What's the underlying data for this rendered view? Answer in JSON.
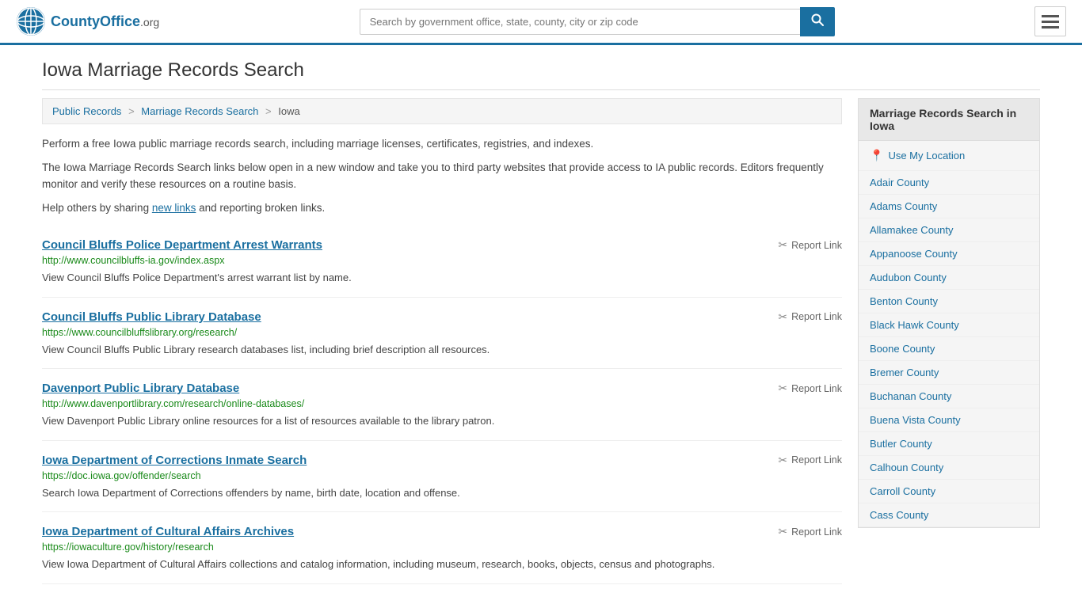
{
  "header": {
    "logo_text": "CountyOffice",
    "logo_org": ".org",
    "search_placeholder": "Search by government office, state, county, city or zip code"
  },
  "page": {
    "title": "Iowa Marriage Records Search",
    "breadcrumb": {
      "items": [
        "Public Records",
        "Marriage Records Search",
        "Iowa"
      ]
    },
    "description1": "Perform a free Iowa public marriage records search, including marriage licenses, certificates, registries, and indexes.",
    "description2": "The Iowa Marriage Records Search links below open in a new window and take you to third party websites that provide access to IA public records. Editors frequently monitor and verify these resources on a routine basis.",
    "description3_before": "Help others by sharing ",
    "description3_link": "new links",
    "description3_after": " and reporting broken links."
  },
  "results": [
    {
      "title": "Council Bluffs Police Department Arrest Warrants",
      "url": "http://www.councilbluffs-ia.gov/index.aspx",
      "description": "View Council Bluffs Police Department's arrest warrant list by name.",
      "report_label": "Report Link"
    },
    {
      "title": "Council Bluffs Public Library Database",
      "url": "https://www.councilbluffslibrary.org/research/",
      "description": "View Council Bluffs Public Library research databases list, including brief description all resources.",
      "report_label": "Report Link"
    },
    {
      "title": "Davenport Public Library Database",
      "url": "http://www.davenportlibrary.com/research/online-databases/",
      "description": "View Davenport Public Library online resources for a list of resources available to the library patron.",
      "report_label": "Report Link"
    },
    {
      "title": "Iowa Department of Corrections Inmate Search",
      "url": "https://doc.iowa.gov/offender/search",
      "description": "Search Iowa Department of Corrections offenders by name, birth date, location and offense.",
      "report_label": "Report Link"
    },
    {
      "title": "Iowa Department of Cultural Affairs Archives",
      "url": "https://iowaculture.gov/history/research",
      "description": "View Iowa Department of Cultural Affairs collections and catalog information, including museum, research, books, objects, census and photographs.",
      "report_label": "Report Link"
    }
  ],
  "sidebar": {
    "title": "Marriage Records Search in Iowa",
    "location_label": "Use My Location",
    "counties": [
      "Adair County",
      "Adams County",
      "Allamakee County",
      "Appanoose County",
      "Audubon County",
      "Benton County",
      "Black Hawk County",
      "Boone County",
      "Bremer County",
      "Buchanan County",
      "Buena Vista County",
      "Butler County",
      "Calhoun County",
      "Carroll County",
      "Cass County"
    ]
  }
}
